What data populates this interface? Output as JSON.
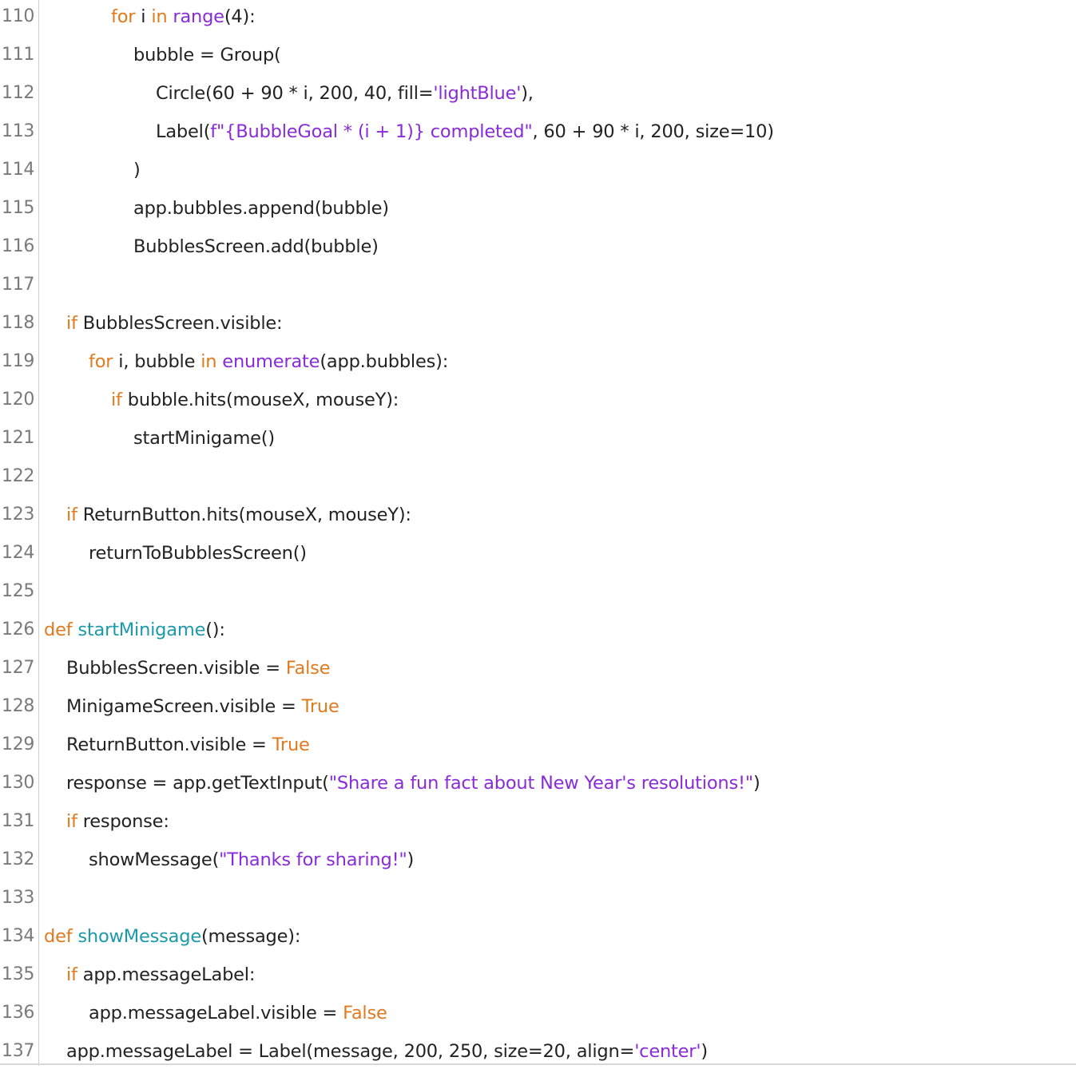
{
  "editor": {
    "language": "python",
    "colors": {
      "keyword": "#e07a1e",
      "builtin": "#8a2bd8",
      "string": "#8a2bd8",
      "function_name": "#1a9aaa",
      "plain": "#222222",
      "line_number": "#7a7a7a"
    },
    "lines": [
      {
        "num": "110",
        "indent": 3,
        "tokens": [
          {
            "t": "kw",
            "v": "for"
          },
          {
            "t": "plain",
            "v": " i "
          },
          {
            "t": "kw",
            "v": "in"
          },
          {
            "t": "plain",
            "v": " "
          },
          {
            "t": "bi",
            "v": "range"
          },
          {
            "t": "plain",
            "v": "(4):"
          }
        ]
      },
      {
        "num": "111",
        "indent": 4,
        "tokens": [
          {
            "t": "plain",
            "v": "bubble = Group("
          }
        ]
      },
      {
        "num": "112",
        "indent": 5,
        "tokens": [
          {
            "t": "plain",
            "v": "Circle(60 + 90 * i, 200, 40, fill="
          },
          {
            "t": "str",
            "v": "'lightBlue'"
          },
          {
            "t": "plain",
            "v": "),"
          }
        ]
      },
      {
        "num": "113",
        "indent": 5,
        "tokens": [
          {
            "t": "plain",
            "v": "Label("
          },
          {
            "t": "str",
            "v": "f\"{BubbleGoal * (i + 1)} completed\""
          },
          {
            "t": "plain",
            "v": ", 60 + 90 * i, 200, size=10)"
          }
        ]
      },
      {
        "num": "114",
        "indent": 4,
        "tokens": [
          {
            "t": "plain",
            "v": ")"
          }
        ]
      },
      {
        "num": "115",
        "indent": 4,
        "tokens": [
          {
            "t": "plain",
            "v": "app.bubbles.append(bubble)"
          }
        ]
      },
      {
        "num": "116",
        "indent": 4,
        "tokens": [
          {
            "t": "plain",
            "v": "BubblesScreen.add(bubble)"
          }
        ]
      },
      {
        "num": "117",
        "indent": 0,
        "tokens": []
      },
      {
        "num": "118",
        "indent": 1,
        "tokens": [
          {
            "t": "kw",
            "v": "if"
          },
          {
            "t": "plain",
            "v": " BubblesScreen.visible:"
          }
        ]
      },
      {
        "num": "119",
        "indent": 2,
        "tokens": [
          {
            "t": "kw",
            "v": "for"
          },
          {
            "t": "plain",
            "v": " i, bubble "
          },
          {
            "t": "kw",
            "v": "in"
          },
          {
            "t": "plain",
            "v": " "
          },
          {
            "t": "bi",
            "v": "enumerate"
          },
          {
            "t": "plain",
            "v": "(app.bubbles):"
          }
        ]
      },
      {
        "num": "120",
        "indent": 3,
        "tokens": [
          {
            "t": "kw",
            "v": "if"
          },
          {
            "t": "plain",
            "v": " bubble.hits(mouseX, mouseY):"
          }
        ]
      },
      {
        "num": "121",
        "indent": 4,
        "tokens": [
          {
            "t": "plain",
            "v": "startMinigame()"
          }
        ]
      },
      {
        "num": "122",
        "indent": 0,
        "tokens": []
      },
      {
        "num": "123",
        "indent": 1,
        "tokens": [
          {
            "t": "kw",
            "v": "if"
          },
          {
            "t": "plain",
            "v": " ReturnButton.hits(mouseX, mouseY):"
          }
        ]
      },
      {
        "num": "124",
        "indent": 2,
        "tokens": [
          {
            "t": "plain",
            "v": "returnToBubblesScreen()"
          }
        ]
      },
      {
        "num": "125",
        "indent": 0,
        "tokens": []
      },
      {
        "num": "126",
        "indent": 0,
        "tokens": [
          {
            "t": "kw",
            "v": "def"
          },
          {
            "t": "plain",
            "v": " "
          },
          {
            "t": "fn",
            "v": "startMinigame"
          },
          {
            "t": "plain",
            "v": "():"
          }
        ]
      },
      {
        "num": "127",
        "indent": 1,
        "tokens": [
          {
            "t": "plain",
            "v": "BubblesScreen.visible = "
          },
          {
            "t": "kw",
            "v": "False"
          }
        ]
      },
      {
        "num": "128",
        "indent": 1,
        "tokens": [
          {
            "t": "plain",
            "v": "MinigameScreen.visible = "
          },
          {
            "t": "kw",
            "v": "True"
          }
        ]
      },
      {
        "num": "129",
        "indent": 1,
        "tokens": [
          {
            "t": "plain",
            "v": "ReturnButton.visible = "
          },
          {
            "t": "kw",
            "v": "True"
          }
        ]
      },
      {
        "num": "130",
        "indent": 1,
        "tokens": [
          {
            "t": "plain",
            "v": "response = app.getTextInput("
          },
          {
            "t": "str",
            "v": "\"Share a fun fact about New Year's resolutions!\""
          },
          {
            "t": "plain",
            "v": ")"
          }
        ]
      },
      {
        "num": "131",
        "indent": 1,
        "tokens": [
          {
            "t": "kw",
            "v": "if"
          },
          {
            "t": "plain",
            "v": " response:"
          }
        ]
      },
      {
        "num": "132",
        "indent": 2,
        "tokens": [
          {
            "t": "plain",
            "v": "showMessage("
          },
          {
            "t": "str",
            "v": "\"Thanks for sharing!\""
          },
          {
            "t": "plain",
            "v": ")"
          }
        ]
      },
      {
        "num": "133",
        "indent": 0,
        "tokens": []
      },
      {
        "num": "134",
        "indent": 0,
        "tokens": [
          {
            "t": "kw",
            "v": "def"
          },
          {
            "t": "plain",
            "v": " "
          },
          {
            "t": "fn",
            "v": "showMessage"
          },
          {
            "t": "plain",
            "v": "(message):"
          }
        ]
      },
      {
        "num": "135",
        "indent": 1,
        "tokens": [
          {
            "t": "kw",
            "v": "if"
          },
          {
            "t": "plain",
            "v": " app.messageLabel:"
          }
        ]
      },
      {
        "num": "136",
        "indent": 2,
        "tokens": [
          {
            "t": "plain",
            "v": "app.messageLabel.visible = "
          },
          {
            "t": "kw",
            "v": "False"
          }
        ]
      },
      {
        "num": "137",
        "indent": 1,
        "tokens": [
          {
            "t": "plain",
            "v": "app.messageLabel = Label(message, 200, 250, size=20, align="
          },
          {
            "t": "str",
            "v": "'center'"
          },
          {
            "t": "plain",
            "v": ")"
          }
        ]
      }
    ]
  }
}
